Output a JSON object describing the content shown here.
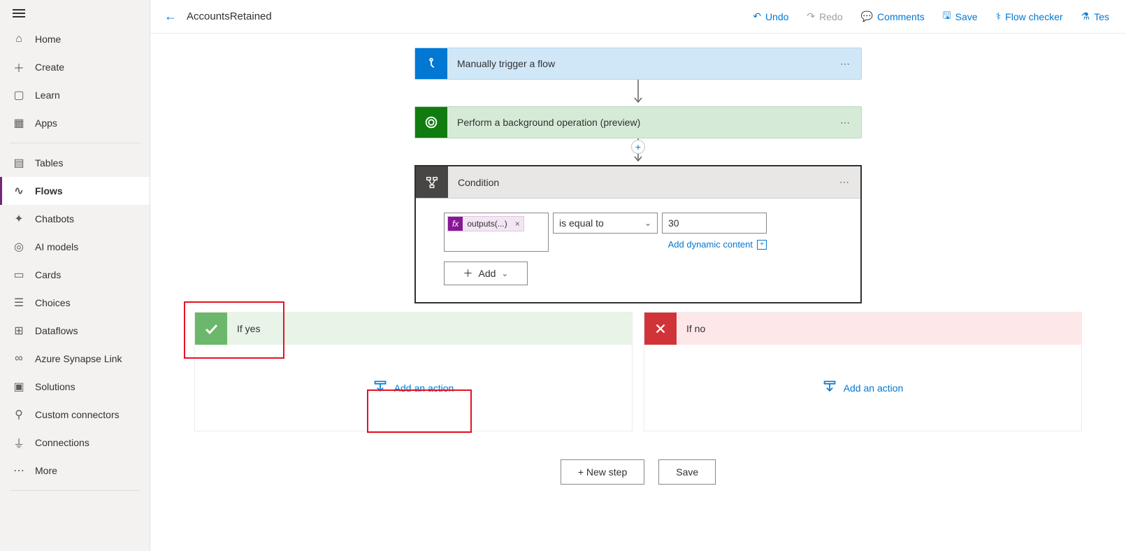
{
  "sidebar": {
    "items": [
      {
        "label": "Home"
      },
      {
        "label": "Create"
      },
      {
        "label": "Learn"
      },
      {
        "label": "Apps"
      },
      {
        "label": "Tables"
      },
      {
        "label": "Flows"
      },
      {
        "label": "Chatbots"
      },
      {
        "label": "AI models"
      },
      {
        "label": "Cards"
      },
      {
        "label": "Choices"
      },
      {
        "label": "Dataflows"
      },
      {
        "label": "Azure Synapse Link"
      },
      {
        "label": "Solutions"
      },
      {
        "label": "Custom connectors"
      },
      {
        "label": "Connections"
      },
      {
        "label": "More"
      }
    ]
  },
  "topbar": {
    "title": "AccountsRetained",
    "undo": "Undo",
    "redo": "Redo",
    "comments": "Comments",
    "save": "Save",
    "flowchecker": "Flow checker",
    "test": "Tes"
  },
  "steps": {
    "trigger": "Manually trigger a flow",
    "background": "Perform a background operation (preview)",
    "condition": "Condition"
  },
  "condition": {
    "token": "outputs(...)",
    "operator": "is equal to",
    "value": "30",
    "dynamic": "Add dynamic content",
    "add": "Add"
  },
  "branches": {
    "yes_label": "If yes",
    "no_label": "If no",
    "add_action": "Add an action"
  },
  "bottom": {
    "newstep": "+ New step",
    "save": "Save"
  }
}
